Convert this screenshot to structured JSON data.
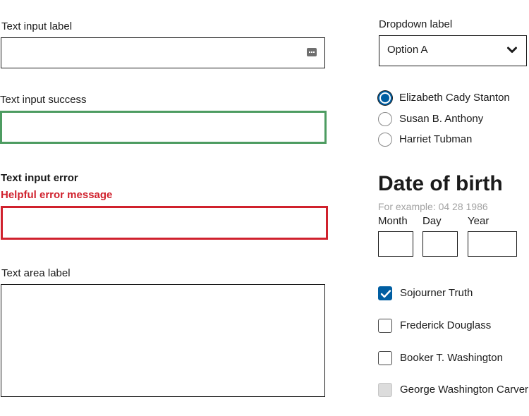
{
  "text_input": {
    "label": "Text input label",
    "value": "",
    "icon": "more-dots-icon"
  },
  "text_input_success": {
    "label": "Text input success",
    "value": ""
  },
  "text_input_error": {
    "label": "Text input error",
    "error_message": "Helpful error message",
    "value": ""
  },
  "text_area": {
    "label": "Text area label",
    "value": ""
  },
  "dropdown": {
    "label": "Dropdown label",
    "selected": "Option A",
    "icon": "chevron-down-icon"
  },
  "radios": [
    {
      "label": "Elizabeth Cady Stanton",
      "checked": true
    },
    {
      "label": "Susan B. Anthony",
      "checked": false
    },
    {
      "label": "Harriet Tubman",
      "checked": false
    }
  ],
  "date_of_birth": {
    "legend": "Date of birth",
    "hint": "For example: 04 28 1986",
    "month_label": "Month",
    "day_label": "Day",
    "year_label": "Year",
    "month_value": "",
    "day_value": "",
    "year_value": ""
  },
  "checkboxes": [
    {
      "label": "Sojourner Truth",
      "checked": true,
      "disabled": false
    },
    {
      "label": "Frederick Douglass",
      "checked": false,
      "disabled": false
    },
    {
      "label": "Booker T. Washington",
      "checked": false,
      "disabled": false
    },
    {
      "label": "George Washington Carver",
      "checked": false,
      "disabled": true
    }
  ],
  "colors": {
    "primary": "#005ea2",
    "success": "#4d9c61",
    "error": "#d0212d",
    "hint": "#a3a3a3"
  }
}
